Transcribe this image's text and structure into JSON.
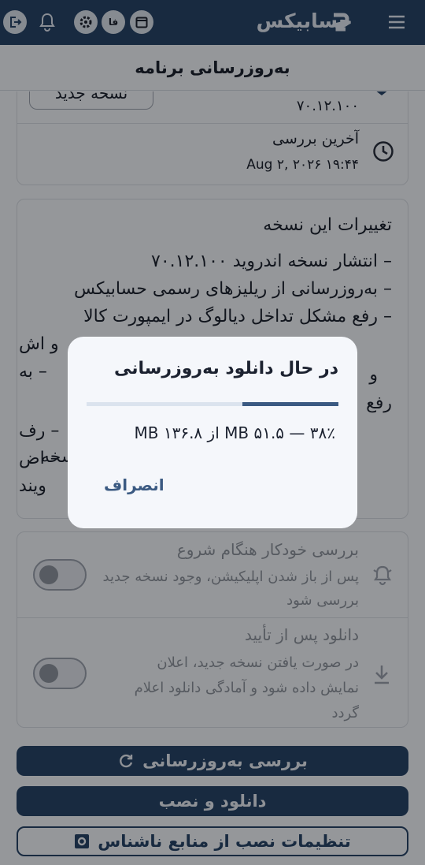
{
  "app": {
    "brand": "حسابیکس",
    "page_title": "به‌روزرسانی برنامه",
    "language_badge": "فا"
  },
  "version_card": {
    "new_version_button": "نسخه جدید",
    "version_value": "۷۰.۱۲.۱۰۰",
    "last_check_label": "آخرین بررسی",
    "last_check_value": "Aug ۲, ۲۰۲۶ ۱۹:۴۴"
  },
  "changelog": {
    "title": "تغییرات این نسخه",
    "lines": [
      "– انتشار نسخه اندروید ۷۰.۱۲.۱۰۰",
      "– به‌روزرسانی از ریلیزهای رسمی حسابیکس",
      "– رفع مشکل تداخل دیالوگ در ایمپورت کالا",
      "و اش",
      "– به",
      "و",
      "رفع",
      "– رف",
      "– اض",
      "نسخه",
      "ویند"
    ]
  },
  "settings": {
    "auto_check": {
      "title": "بررسی خودکار هنگام شروع",
      "description": "پس از باز شدن اپلیکیشن، وجود نسخه جدید بررسی شود",
      "enabled": false
    },
    "download_after_confirm": {
      "title": "دانلود پس از تأیید",
      "description": "در صورت یافتن نسخه جدید، اعلان نمایش داده شود و آمادگی دانلود اعلام گردد",
      "enabled": false
    }
  },
  "actions": {
    "check_updates": "بررسی به‌روزرسانی",
    "download_install": "دانلود و نصب",
    "unknown_sources": "تنظیمات نصب از منابع ناشناس"
  },
  "dialog": {
    "title": "در حال دانلود به‌روزرسانی",
    "progress_percent": 38,
    "progress_text": "۳۸٪ — ۵۱.۵ MB از ۱۳۶.۸ MB",
    "cancel": "انصراف"
  },
  "colors": {
    "primary": "#274468",
    "accent": "#3b5a82",
    "background": "#f1f4f8"
  },
  "icons": [
    "menu-icon",
    "logout-icon",
    "bell-icon",
    "gear-icon",
    "calendar-icon",
    "history-icon",
    "notification-icon",
    "download-icon",
    "refresh-icon",
    "shield-icon"
  ]
}
